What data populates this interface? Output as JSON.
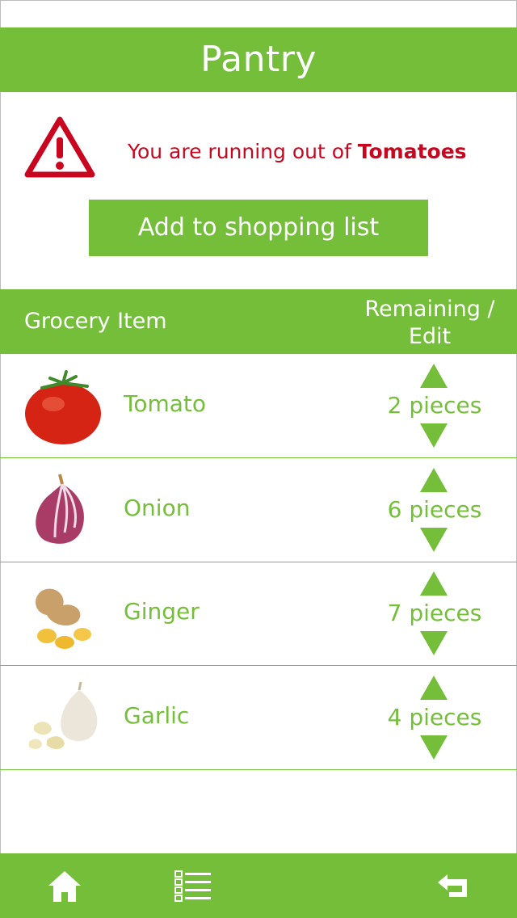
{
  "header": {
    "title": "Pantry"
  },
  "alert": {
    "message_prefix": "You are running out of ",
    "item": "Tomatoes",
    "add_button": "Add to shopping list",
    "icon": "warning-triangle-icon"
  },
  "table": {
    "headers": {
      "item": "Grocery Item",
      "remaining_line1": "Remaining /",
      "remaining_line2": "Edit"
    },
    "rows": [
      {
        "name": "Tomato",
        "qty": "2 pieces"
      },
      {
        "name": "Onion",
        "qty": "6 pieces"
      },
      {
        "name": "Ginger",
        "qty": "7 pieces"
      },
      {
        "name": "Garlic",
        "qty": "4 pieces"
      }
    ]
  },
  "footer": {
    "icons": [
      "home-icon",
      "list-icon",
      "back-icon"
    ]
  },
  "colors": {
    "accent": "#74be3a",
    "alert": "#c9061f"
  }
}
